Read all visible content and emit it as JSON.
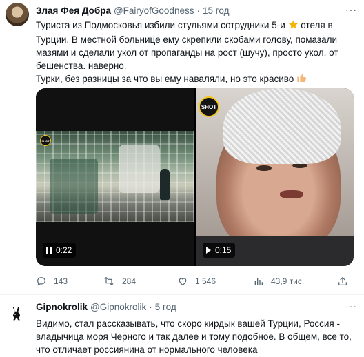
{
  "tweet1": {
    "name": "Злая Фея Добра",
    "handle": "@FairyofGoodness",
    "separator": "·",
    "time": "15 год",
    "more": "···",
    "text_line1_a": "Туриста из Подмосковья избили стульями сотрудники 5-и ",
    "text_line1_b": " отеля в Турции. В местной больнице ему скрепили скобами голову, помазали мазями и сделали укол от пропаганды на рост (шучу), просто укол. от бешенства. наверно.",
    "text_line2": "Турки, без разницы за что вы ему наваляли, но это красиво ",
    "star_icon": "star-icon",
    "thumb_icon": "thumbs-up-icon",
    "videos": [
      {
        "duration": "0:22",
        "state": "pause",
        "logo": "SHOT"
      },
      {
        "duration": "0:15",
        "state": "play",
        "logo": "SHOT"
      }
    ],
    "actions": {
      "replies": "143",
      "retweets": "284",
      "likes": "1 546",
      "views": "43,9 тис."
    }
  },
  "tweet2": {
    "name": "Gipnokrolik",
    "handle": "@Gipnokrolik",
    "separator": "·",
    "time": "5 год",
    "more": "···",
    "text": "Видимо, стал рассказывать, что скоро кирдык вашей Турции, Россия - владычица моря Черного и так далее и тому подобное. В общем, все то, что отличает россиянина от нормального человека"
  },
  "colors": {
    "text": "#0f1419",
    "muted": "#536471",
    "star": "#f4b400",
    "thumb": "#f2b779",
    "divider": "#eff3f4"
  }
}
